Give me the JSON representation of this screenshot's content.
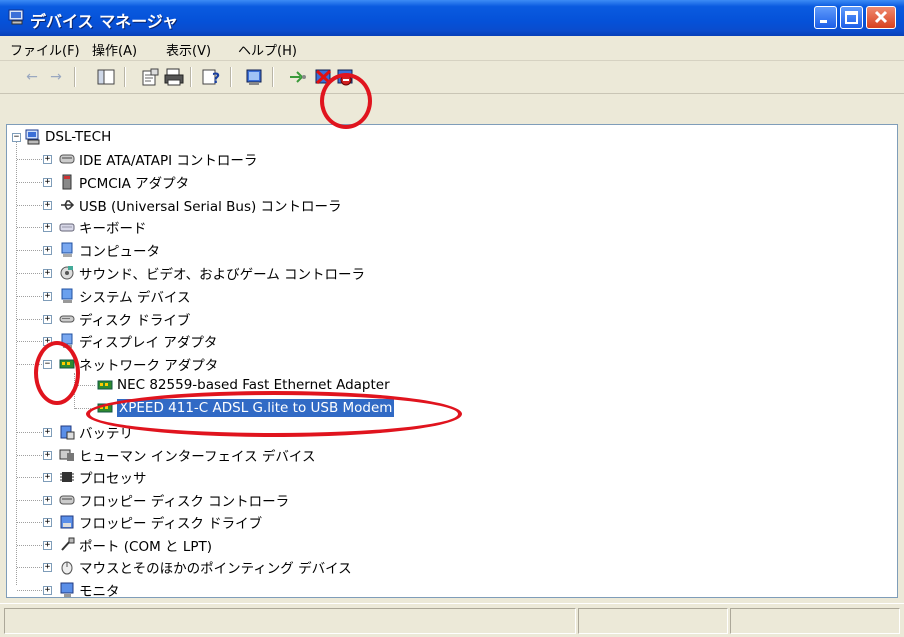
{
  "window": {
    "title": "デバイス マネージャ",
    "colors": {
      "titlebar": "#0a5be0",
      "selection": "#316ac5",
      "annotation": "#e0141e"
    }
  },
  "menu": [
    {
      "label": "ファイル(F)"
    },
    {
      "label": "操作(A)"
    },
    {
      "label": "表示(V)"
    },
    {
      "label": "ヘルプ(H)"
    }
  ],
  "toolbar": {
    "icons": [
      "back-arrow-icon",
      "forward-arrow-icon",
      "show-hide-console-tree-icon",
      "properties-icon",
      "print-icon",
      "help-icon",
      "scan-hardware-icon",
      "update-driver-icon",
      "uninstall-icon",
      "disable-icon"
    ]
  },
  "tree": {
    "root": "DSL-TECH",
    "items": [
      {
        "label": "IDE ATA/ATAPI コントローラ",
        "icon": "ide-controller-icon",
        "expander": "+"
      },
      {
        "label": "PCMCIA アダプタ",
        "icon": "pcmcia-icon",
        "expander": "+"
      },
      {
        "label": "USB (Universal Serial Bus) コントローラ",
        "icon": "usb-icon",
        "expander": "+"
      },
      {
        "label": "キーボード",
        "icon": "keyboard-icon",
        "expander": "+"
      },
      {
        "label": "コンピュータ",
        "icon": "computer-icon",
        "expander": "+"
      },
      {
        "label": "サウンド、ビデオ、およびゲーム コントローラ",
        "icon": "sound-icon",
        "expander": "+"
      },
      {
        "label": "システム デバイス",
        "icon": "system-device-icon",
        "expander": "+"
      },
      {
        "label": "ディスク ドライブ",
        "icon": "disk-drive-icon",
        "expander": "+"
      },
      {
        "label": "ディスプレイ アダプタ",
        "icon": "display-adapter-icon",
        "expander": "+"
      },
      {
        "label": "ネットワーク アダプタ",
        "icon": "network-adapter-icon",
        "expander": "−"
      }
    ],
    "network_children": [
      {
        "label": "NEC 82559-based Fast Ethernet Adapter",
        "icon": "network-card-icon"
      },
      {
        "label": "XPEED 411-C ADSL G.lite to USB Modem",
        "icon": "network-card-icon",
        "selected": true
      }
    ],
    "items_after": [
      {
        "label": "バッテリ",
        "icon": "battery-icon",
        "expander": "+"
      },
      {
        "label": "ヒューマン インターフェイス デバイス",
        "icon": "hid-icon",
        "expander": "+"
      },
      {
        "label": "プロセッサ",
        "icon": "processor-icon",
        "expander": "+"
      },
      {
        "label": "フロッピー ディスク コントローラ",
        "icon": "floppy-controller-icon",
        "expander": "+"
      },
      {
        "label": "フロッピー ディスク ドライブ",
        "icon": "floppy-drive-icon",
        "expander": "+"
      },
      {
        "label": "ポート (COM と LPT)",
        "icon": "port-icon",
        "expander": "+"
      },
      {
        "label": "マウスとそのほかのポインティング デバイス",
        "icon": "mouse-icon",
        "expander": "+"
      },
      {
        "label": "モニタ",
        "icon": "monitor-icon",
        "expander": "+"
      }
    ]
  }
}
